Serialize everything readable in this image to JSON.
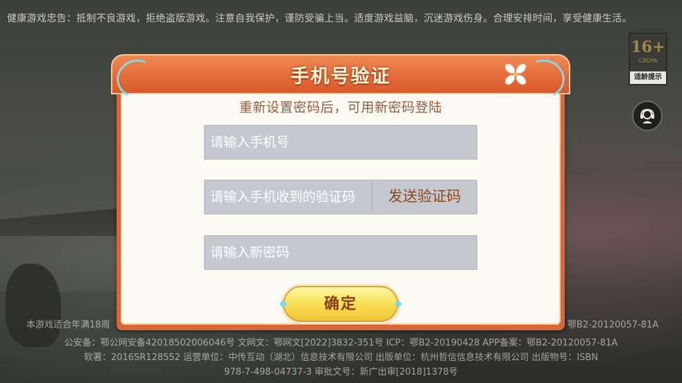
{
  "health_notice": "健康游戏忠告：抵制不良游戏，拒绝盗版游戏。注意自我保护，谨防受骗上当。适度游戏益脑，沉迷游戏伤身。合理安排时间，享受健康生活。",
  "age_badge": {
    "age": "16+",
    "org": "CADPA",
    "tip": "适龄提示"
  },
  "dialog": {
    "title": "手机号验证",
    "subtitle": "重新设置密码后，可用新密码登陆",
    "phone_placeholder": "请输入手机号",
    "code_placeholder": "请输入手机收到的验证码",
    "send_code_label": "发送验证码",
    "password_placeholder": "请输入新密码",
    "confirm_label": "确定"
  },
  "footer": {
    "line1_left": "本游戏适合年满18周",
    "line1_right": "鄂B2-20120057-81A",
    "line2": "公安备：鄂公网安备42018502006046号 文网文：鄂网文[2022]3832-351号 ICP：鄂B2-20190428 APP备案：鄂B2-20120057-81A",
    "line3": "软著：2016SR128552 运营单位：中传互动（湖北）信息技术有限公司 出版单位：杭州哲信信息技术有限公司 出版物号：ISBN",
    "line4": "978-7-498-04737-3 审批文号：新广出审[2018]1378号"
  },
  "colors": {
    "header_orange": "#e36a37",
    "body_cream": "#fdfaf4",
    "field_gray": "#c5c8cf",
    "button_yellow": "#f9e15a",
    "title_text": "#fff7d8",
    "send_code_text": "#8a4a1e"
  },
  "icons": {
    "close": "close-icon",
    "customer_service": "customer-service-icon"
  }
}
